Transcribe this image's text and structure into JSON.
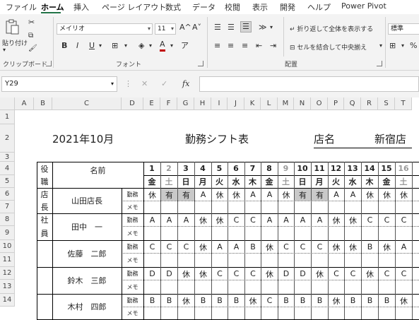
{
  "menu": {
    "tabs": [
      "ファイル",
      "ホーム",
      "挿入",
      "ページ レイアウト",
      "数式",
      "データ",
      "校閲",
      "表示",
      "開発",
      "ヘルプ",
      "Power Pivot"
    ],
    "active_tab": "ホーム"
  },
  "ribbon": {
    "clipboard": {
      "paste_label": "貼り付け",
      "group_label": "クリップボード"
    },
    "font": {
      "font_name": "メイリオ",
      "font_size": "11",
      "bold": "B",
      "italic": "I",
      "underline": "U",
      "font_color_glyph": "A",
      "grow": "A^",
      "shrink": "A˅",
      "group_label": "フォント"
    },
    "alignment": {
      "wrap_text": "折り返して全体を表示する",
      "merge_center": "セルを結合して中央揃え",
      "group_label": "配置"
    },
    "number": {
      "format": "標準",
      "percent": "%",
      "comma": "⁹"
    }
  },
  "formula_bar": {
    "name_box": "Y29",
    "fx": "fx",
    "value": ""
  },
  "columns": [
    "A",
    "B",
    "C",
    "D",
    "E",
    "F",
    "G",
    "H",
    "I",
    "J",
    "K",
    "L",
    "M",
    "N",
    "O",
    "P",
    "Q",
    "R",
    "S",
    "T"
  ],
  "rows": [
    "1",
    "2",
    "3",
    "4",
    "5",
    "6",
    "7",
    "8",
    "9",
    "10",
    "11",
    "12",
    "13",
    "14"
  ],
  "sheet": {
    "title_month": "2021年10月",
    "title": "勤務シフト表",
    "store_label": "店名",
    "store_name": "新宿店",
    "header": {
      "role": "役職",
      "role_a": "役",
      "role_b": "職",
      "name": "名前"
    },
    "days": [
      "1",
      "2",
      "3",
      "4",
      "5",
      "6",
      "7",
      "8",
      "9",
      "10",
      "11",
      "12",
      "13",
      "14",
      "15",
      "16"
    ],
    "weekdays": [
      "金",
      "土",
      "日",
      "月",
      "火",
      "水",
      "木",
      "金",
      "土",
      "日",
      "月",
      "火",
      "水",
      "木",
      "金",
      "土"
    ],
    "row_labels": {
      "shift": "勤務",
      "memo": "メモ"
    },
    "staff": [
      {
        "role_a": "店",
        "role_b": "長",
        "name": "山田店長",
        "shifts": [
          "休",
          "有",
          "有",
          "A",
          "休",
          "休",
          "A",
          "A",
          "休",
          "有",
          "有",
          "A",
          "A",
          "休",
          "休",
          "休"
        ]
      },
      {
        "role_a": "社",
        "role_b": "員",
        "name": "田中　一",
        "shifts": [
          "A",
          "A",
          "A",
          "休",
          "休",
          "C",
          "C",
          "A",
          "A",
          "A",
          "A",
          "休",
          "休",
          "C",
          "C",
          "C"
        ]
      },
      {
        "role_a": "",
        "role_b": "",
        "name": "佐藤　二郎",
        "shifts": [
          "C",
          "C",
          "C",
          "休",
          "A",
          "A",
          "B",
          "休",
          "C",
          "C",
          "C",
          "休",
          "休",
          "B",
          "休",
          "A"
        ]
      },
      {
        "role_a": "",
        "role_b": "",
        "name": "鈴木　三郎",
        "shifts": [
          "D",
          "D",
          "休",
          "休",
          "C",
          "C",
          "C",
          "休",
          "D",
          "D",
          "休",
          "C",
          "C",
          "休",
          "C",
          "C"
        ]
      },
      {
        "role_a": "",
        "role_b": "",
        "name": "木村　四郎",
        "shifts": [
          "B",
          "B",
          "休",
          "B",
          "B",
          "B",
          "休",
          "C",
          "B",
          "B",
          "B",
          "休",
          "B",
          "B",
          "B",
          "休"
        ]
      }
    ]
  }
}
